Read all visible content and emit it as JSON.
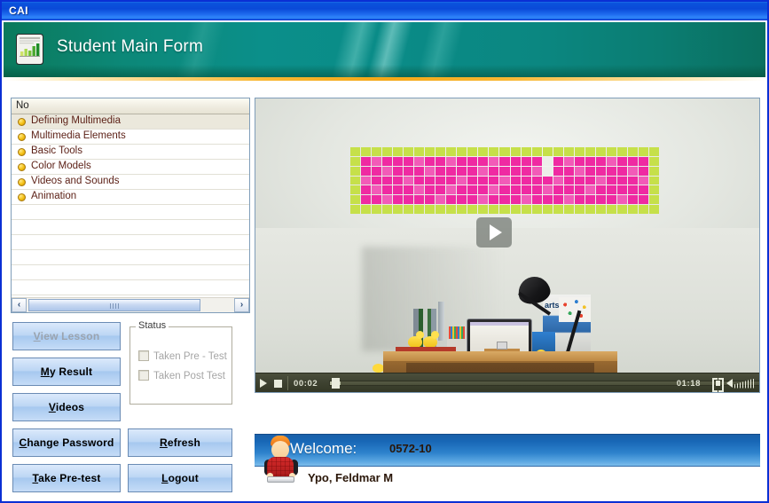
{
  "window": {
    "title": "CAI"
  },
  "header": {
    "title": "Student Main Form",
    "icon": "report-chart-icon"
  },
  "lesson_list": {
    "column_header": "No",
    "items": [
      {
        "label": "Defining Multimedia",
        "selected": true
      },
      {
        "label": "Multimedia Elements",
        "selected": false
      },
      {
        "label": "Basic Tools",
        "selected": false
      },
      {
        "label": "Color Models",
        "selected": false
      },
      {
        "label": "Videos and Sounds",
        "selected": false
      },
      {
        "label": "Animation",
        "selected": false
      }
    ],
    "empty_rows": 7,
    "scrollbar": {
      "left_arrow": "‹",
      "right_arrow": "›"
    }
  },
  "buttons": {
    "view_lesson": "View Lesson",
    "my_result": "My Result",
    "videos": "Videos",
    "change_password": "Change Password",
    "take_pretest": "Take Pre-test",
    "refresh": "Refresh",
    "logout": "Logout"
  },
  "status_group": {
    "legend": "Status",
    "taken_pre_test": "Taken Pre - Test",
    "taken_post_test": "Taken Post Test"
  },
  "video": {
    "current_time": "00:02",
    "duration": "01:18",
    "play_label": "play-icon",
    "stop_label": "stop-icon",
    "fullscreen_label": "fullscreen-icon",
    "volume_label": "volume-icon",
    "overlay": "play-overlay-icon"
  },
  "welcome": {
    "label": "Welcome:",
    "student_id": "0572-10",
    "student_name": "Ypo, Feldmar M"
  },
  "colors": {
    "titlebar_blue": "#0a52dc",
    "banner_teal": "#0b8f8a",
    "banner_rule_gold": "#f5a817",
    "button_blue": "#bcd6f4",
    "list_text": "#5b1f15",
    "bullet_gold": "#f5c218",
    "welcome_blue": "#2d82cc",
    "video_bar": "#3e4231"
  }
}
